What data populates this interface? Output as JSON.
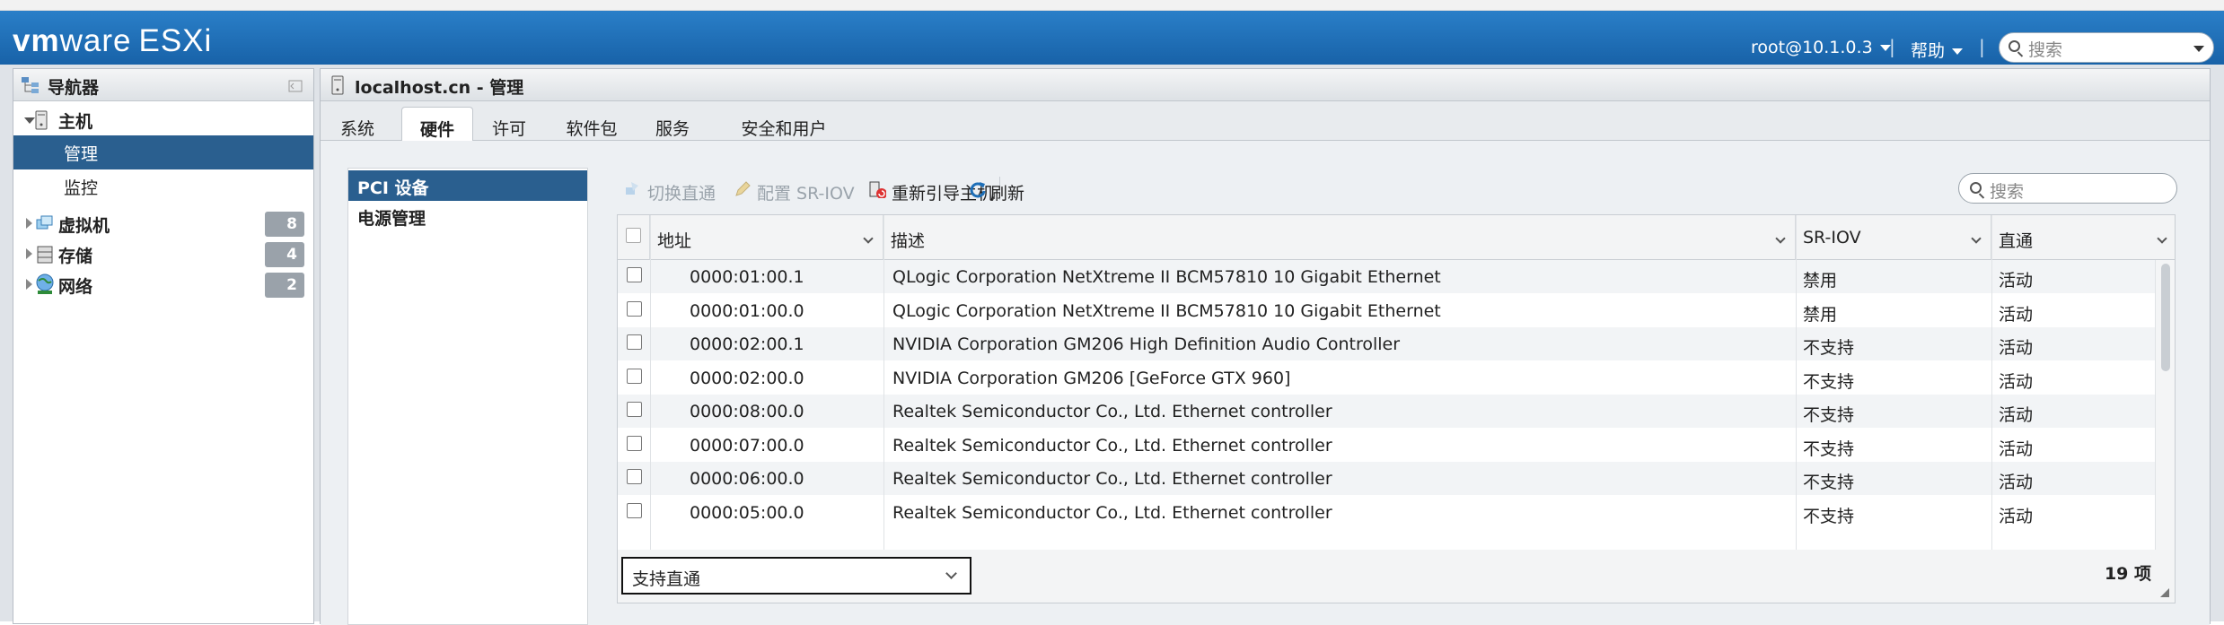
{
  "app": {
    "brand_vm": "vm",
    "brand_ware": "ware",
    "brand_product": "ESXi"
  },
  "topbar": {
    "user": "root@10.1.0.3",
    "help": "帮助",
    "separator": "|",
    "search_placeholder": "搜索"
  },
  "navigator": {
    "title": "导航器",
    "items": [
      {
        "label": "主机",
        "badge": ""
      },
      {
        "label": "管理",
        "badge": ""
      },
      {
        "label": "监控",
        "badge": ""
      },
      {
        "label": "虚拟机",
        "badge": "8"
      },
      {
        "label": "存储",
        "badge": "4"
      },
      {
        "label": "网络",
        "badge": "2"
      }
    ]
  },
  "main": {
    "title": "localhost.cn - 管理",
    "tabs": [
      {
        "label": "系统"
      },
      {
        "label": "硬件"
      },
      {
        "label": "许可"
      },
      {
        "label": "软件包"
      },
      {
        "label": "服务"
      },
      {
        "label": "安全和用户"
      }
    ],
    "left_menu": [
      {
        "label": "PCI 设备"
      },
      {
        "label": "电源管理"
      }
    ],
    "toolbar": {
      "toggle_passthrough": "切换直通",
      "configure_sriov": "配置 SR-IOV",
      "reboot_host": "重新引导主机",
      "refresh": "刷新",
      "search_placeholder": "搜索"
    },
    "table": {
      "columns": [
        "地址",
        "描述",
        "SR-IOV",
        "直通"
      ],
      "rows": [
        {
          "addr": "0000:01:00.1",
          "desc": "QLogic Corporation NetXtreme II BCM57810 10 Gigabit Ethernet",
          "sriov": "禁用",
          "pass": "活动"
        },
        {
          "addr": "0000:01:00.0",
          "desc": "QLogic Corporation NetXtreme II BCM57810 10 Gigabit Ethernet",
          "sriov": "禁用",
          "pass": "活动"
        },
        {
          "addr": "0000:02:00.1",
          "desc": "NVIDIA Corporation GM206 High Definition Audio Controller",
          "sriov": "不支持",
          "pass": "活动"
        },
        {
          "addr": "0000:02:00.0",
          "desc": "NVIDIA Corporation GM206 [GeForce GTX 960]",
          "sriov": "不支持",
          "pass": "活动"
        },
        {
          "addr": "0000:08:00.0",
          "desc": "Realtek Semiconductor Co., Ltd. Ethernet controller",
          "sriov": "不支持",
          "pass": "活动"
        },
        {
          "addr": "0000:07:00.0",
          "desc": "Realtek Semiconductor Co., Ltd. Ethernet controller",
          "sriov": "不支持",
          "pass": "活动"
        },
        {
          "addr": "0000:06:00.0",
          "desc": "Realtek Semiconductor Co., Ltd. Ethernet controller",
          "sriov": "不支持",
          "pass": "活动"
        },
        {
          "addr": "0000:05:00.0",
          "desc": "Realtek Semiconductor Co., Ltd. Ethernet controller",
          "sriov": "不支持",
          "pass": "活动"
        }
      ],
      "filter_value": "支持直通",
      "count": "19 项"
    }
  },
  "colors": {
    "topbar": "#1e6fb8",
    "selected": "#2a5f8f",
    "badge": "#9aa2aa",
    "refresh_icon": "#1e6fb8"
  }
}
